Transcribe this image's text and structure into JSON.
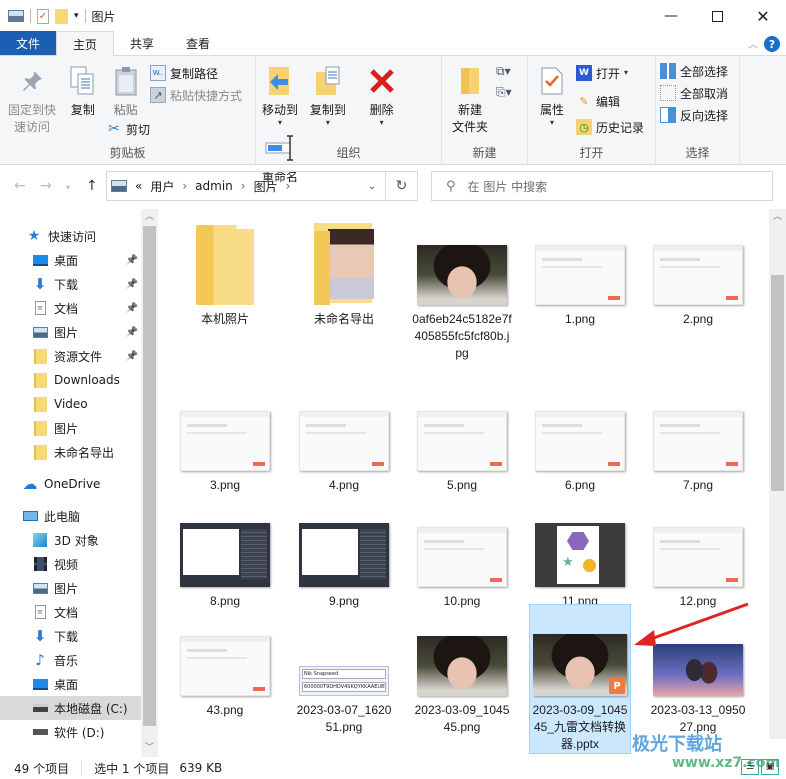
{
  "window": {
    "title": "图片",
    "minimize_icon": "minimize-icon",
    "maximize_icon": "maximize-icon",
    "close_icon": "close-icon"
  },
  "quick_access_toolbar": [
    "picture-icon",
    "properties-check-icon",
    "new-folder-icon",
    "customize-dropdown-icon"
  ],
  "tabs": [
    {
      "label": "文件",
      "type": "file"
    },
    {
      "label": "主页",
      "active": true
    },
    {
      "label": "共享"
    },
    {
      "label": "查看"
    }
  ],
  "help_label": "?",
  "ribbon": {
    "clipboard": {
      "label": "剪贴板",
      "pin": "固定到快速访问",
      "pin_l1": "固定到快",
      "pin_l2": "速访问",
      "copy": "复制",
      "paste": "粘贴",
      "copy_path": "复制路径",
      "paste_shortcut": "粘贴快捷方式",
      "cut": "剪切"
    },
    "organize": {
      "label": "组织",
      "move_to": "移动到",
      "copy_to": "复制到",
      "delete": "删除",
      "rename": "重命名"
    },
    "new": {
      "label": "新建",
      "new_folder_l1": "新建",
      "new_folder_l2": "文件夹"
    },
    "open": {
      "label": "打开",
      "properties": "属性",
      "open": "打开",
      "edit": "编辑",
      "history": "历史记录"
    },
    "select": {
      "label": "选择",
      "select_all": "全部选择",
      "select_none": "全部取消",
      "invert": "反向选择"
    }
  },
  "address": {
    "prefix": "«",
    "crumbs": [
      "用户",
      "admin",
      "图片"
    ],
    "separator": "›"
  },
  "search": {
    "placeholder": "在 图片 中搜索"
  },
  "sidebar": {
    "quick_access": {
      "label": "快速访问"
    },
    "quick_items": [
      {
        "label": "桌面",
        "icon": "desktop-icon",
        "pinned": true
      },
      {
        "label": "下载",
        "icon": "download-icon",
        "pinned": true
      },
      {
        "label": "文档",
        "icon": "document-icon",
        "pinned": true
      },
      {
        "label": "图片",
        "icon": "pictures-icon",
        "pinned": true
      },
      {
        "label": "资源文件",
        "icon": "folder-icon",
        "pinned": true
      },
      {
        "label": "Downloads",
        "icon": "folder-icon"
      },
      {
        "label": "Video",
        "icon": "folder-icon"
      },
      {
        "label": "图片",
        "icon": "folder-icon"
      },
      {
        "label": "未命名导出",
        "icon": "folder-icon"
      }
    ],
    "onedrive": {
      "label": "OneDrive"
    },
    "this_pc": {
      "label": "此电脑"
    },
    "pc_items": [
      {
        "label": "3D 对象",
        "icon": "3d-objects-icon"
      },
      {
        "label": "视频",
        "icon": "videos-icon"
      },
      {
        "label": "图片",
        "icon": "pictures-icon"
      },
      {
        "label": "文档",
        "icon": "document-icon"
      },
      {
        "label": "下载",
        "icon": "download-icon"
      },
      {
        "label": "音乐",
        "icon": "music-icon"
      },
      {
        "label": "桌面",
        "icon": "desktop-icon"
      },
      {
        "label": "本地磁盘 (C:)",
        "icon": "system-drive-icon",
        "selected": true
      },
      {
        "label": "软件 (D:)",
        "icon": "drive-icon"
      }
    ]
  },
  "files": [
    {
      "name": "本机照片",
      "kind": "folder"
    },
    {
      "name": "未命名导出",
      "kind": "folder-photo"
    },
    {
      "name": "0af6eb24c5182e7f405855fc5fcf80b.jpg",
      "kind": "photo"
    },
    {
      "name": "1.png",
      "kind": "screenshot"
    },
    {
      "name": "2.png",
      "kind": "screenshot"
    },
    {
      "name": "3.png",
      "kind": "screenshot"
    },
    {
      "name": "4.png",
      "kind": "screenshot"
    },
    {
      "name": "5.png",
      "kind": "screenshot"
    },
    {
      "name": "6.png",
      "kind": "screenshot"
    },
    {
      "name": "7.png",
      "kind": "screenshot"
    },
    {
      "name": "8.png",
      "kind": "dark-screenshot"
    },
    {
      "name": "9.png",
      "kind": "dark-screenshot"
    },
    {
      "name": "10.png",
      "kind": "screenshot"
    },
    {
      "name": "11.png",
      "kind": "shapes"
    },
    {
      "name": "12.png",
      "kind": "screenshot"
    },
    {
      "name": "43.png",
      "kind": "screenshot"
    },
    {
      "name": "2023-03-07_162051.png",
      "kind": "snapseed"
    },
    {
      "name": "2023-03-09_104545.png",
      "kind": "photo"
    },
    {
      "name": "2023-03-09_104545_九雷文档转换器.pptx",
      "kind": "pptx",
      "selected": true
    },
    {
      "name": "2023-03-13_095027.png",
      "kind": "anime"
    }
  ],
  "snapseed_thumb": {
    "line1": "Nik Snapseed",
    "line2": "600000T9DHDV4SKQYKKAAEU85"
  },
  "status": {
    "count": "49 个项目",
    "selection": "选中 1 个项目",
    "size": "639 KB"
  },
  "watermark": {
    "line1": "极光下载站",
    "line2": "www.xz7.com"
  }
}
